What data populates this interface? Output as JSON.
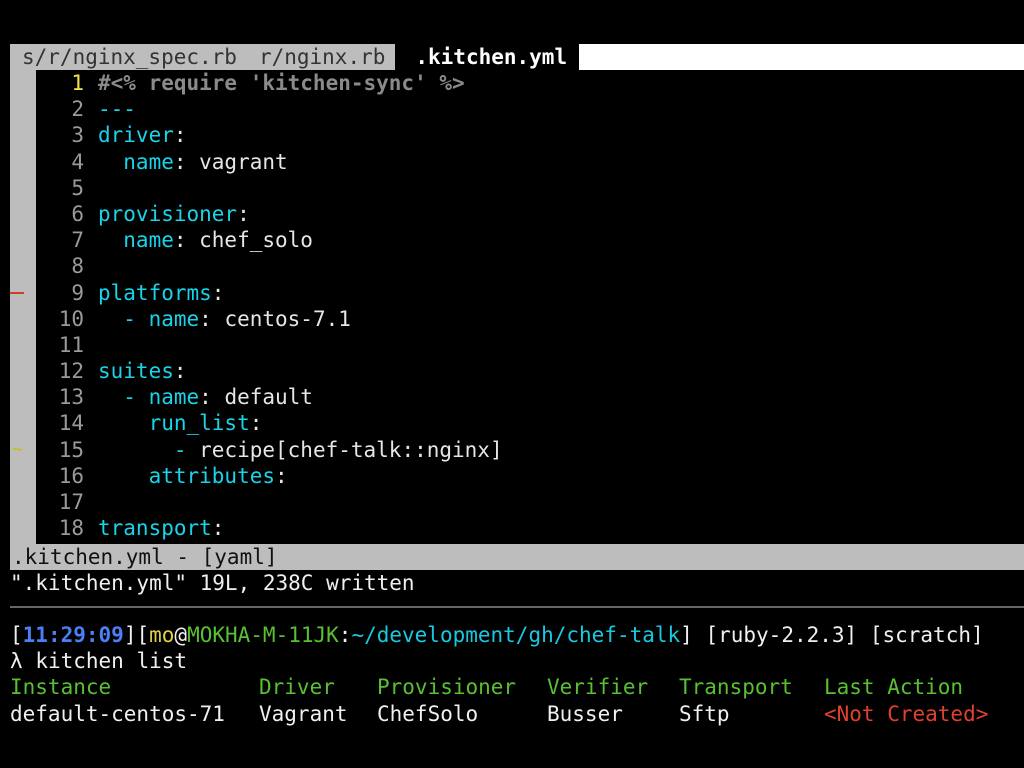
{
  "tabs": [
    {
      "label": "s/r/nginx_spec.rb",
      "active": false
    },
    {
      "label": "r/nginx.rb",
      "active": false
    },
    {
      "label": ".kitchen.yml",
      "active": true
    }
  ],
  "editor": {
    "lines": [
      {
        "n": "1",
        "parts": [
          {
            "t": "#<% require 'kitchen-sync' %>",
            "c": "cmt"
          }
        ]
      },
      {
        "n": "2",
        "parts": [
          {
            "t": "---",
            "c": "key"
          }
        ]
      },
      {
        "n": "3",
        "parts": [
          {
            "t": "driver",
            "c": "key"
          },
          {
            "t": ":",
            "c": "val"
          }
        ]
      },
      {
        "n": "4",
        "parts": [
          {
            "t": "  name",
            "c": "key"
          },
          {
            "t": ": vagrant",
            "c": "val"
          }
        ]
      },
      {
        "n": "5",
        "parts": []
      },
      {
        "n": "6",
        "parts": [
          {
            "t": "provisioner",
            "c": "key"
          },
          {
            "t": ":",
            "c": "val"
          }
        ]
      },
      {
        "n": "7",
        "parts": [
          {
            "t": "  name",
            "c": "key"
          },
          {
            "t": ": chef_solo",
            "c": "val"
          }
        ]
      },
      {
        "n": "8",
        "parts": []
      },
      {
        "n": "9",
        "parts": [
          {
            "t": "platforms",
            "c": "key"
          },
          {
            "t": ":",
            "c": "val"
          }
        ]
      },
      {
        "n": "10",
        "parts": [
          {
            "t": "  - ",
            "c": "dash"
          },
          {
            "t": "name",
            "c": "key"
          },
          {
            "t": ": centos-7.1",
            "c": "val"
          }
        ]
      },
      {
        "n": "11",
        "parts": []
      },
      {
        "n": "12",
        "parts": [
          {
            "t": "suites",
            "c": "key"
          },
          {
            "t": ":",
            "c": "val"
          }
        ]
      },
      {
        "n": "13",
        "parts": [
          {
            "t": "  - ",
            "c": "dash"
          },
          {
            "t": "name",
            "c": "key"
          },
          {
            "t": ": default",
            "c": "val"
          }
        ]
      },
      {
        "n": "14",
        "parts": [
          {
            "t": "    run_list",
            "c": "key"
          },
          {
            "t": ":",
            "c": "val"
          }
        ]
      },
      {
        "n": "15",
        "parts": [
          {
            "t": "      - ",
            "c": "dash"
          },
          {
            "t": "recipe[chef-talk::nginx]",
            "c": "val"
          }
        ]
      },
      {
        "n": "16",
        "parts": [
          {
            "t": "    attributes",
            "c": "key"
          },
          {
            "t": ":",
            "c": "val"
          }
        ]
      },
      {
        "n": "17",
        "parts": []
      },
      {
        "n": "18",
        "parts": [
          {
            "t": "transport",
            "c": "key"
          },
          {
            "t": ":",
            "c": "val"
          }
        ]
      }
    ],
    "current_line": "1",
    "signs": [
      {
        "line": "9",
        "kind": "removed",
        "glyph": "_"
      },
      {
        "line": "15",
        "kind": "modified",
        "glyph": "~"
      }
    ]
  },
  "statusline": ".kitchen.yml - [yaml]",
  "cmdline": "\".kitchen.yml\" 19L, 238C written",
  "shell": {
    "prompt": {
      "time": "11:29:09",
      "user": "mo",
      "host": "MOKHA-M-11JK",
      "path": "~/development/gh/chef-talk",
      "ruby": "[ruby-2.2.3]",
      "session": "[scratch]"
    },
    "command_prefix": "λ",
    "command": "kitchen list",
    "table": {
      "headers": [
        "Instance",
        "Driver",
        "Provisioner",
        "Verifier",
        "Transport",
        "Last Action"
      ],
      "rows": [
        [
          "default-centos-71",
          "Vagrant",
          "ChefSolo",
          "Busser",
          "Sftp",
          "<Not Created>"
        ]
      ]
    }
  },
  "colors": {
    "key": "#19d3e8",
    "comment": "#8a8a8a",
    "current_line_number": "#f5e34a",
    "prompt_time": "#4a7ff5",
    "prompt_user": "#e0d040",
    "prompt_host": "#58c032",
    "table_header": "#58c032",
    "not_created": "#e0402e"
  }
}
